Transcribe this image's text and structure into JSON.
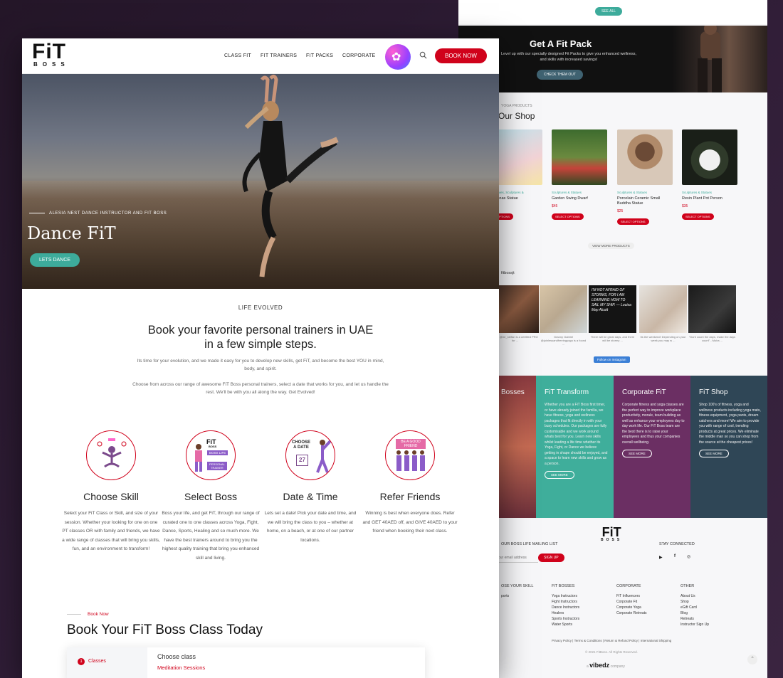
{
  "back": {
    "see_all": "SEE ALL",
    "fit_pack": {
      "title": "Get A Fit Pack",
      "text": "Level up with our specially designed Fit Packs to give you enhanced wellness, and skills with increased savings!",
      "button": "CHECK THEM OUT"
    },
    "shop": {
      "kicker": "YOGA PRODUCTS",
      "title": "Our Shop",
      "products": [
        {
          "category": "Decoratives, Sculptures &",
          "name": "n Bananas Statue",
          "price": "$5",
          "button": "ECT OPTIONS"
        },
        {
          "category": "Sculptures & Statues",
          "name": "Garden Swing Dwarf",
          "price": "$45",
          "button": "SELECT OPTIONS"
        },
        {
          "category": "Sculptures & Statues",
          "name": "Porcelain Ceramic Small Buddha Statue",
          "price": "$25",
          "button": "SELECT OPTIONS"
        },
        {
          "category": "Sculptures & Statues",
          "name": "Resin Plant Pot Person",
          "price": "$35",
          "button": "SELECT OPTIONS"
        }
      ],
      "view_more": "VIEW MORE PRODUCTS"
    },
    "instagram": {
      "handle": "fitbossjt",
      "captions": [
        "Ahhh @mr_stefan is a certified PRO for ...",
        "Granny Gabriel @joinlessandfreeingyoga is a found ...",
        "There will be great days, and there will be stormy ...",
        "Its the weekend! Depending on your week you may w ...",
        "\"Dont count the days, make the days count\" - Muha ..."
      ],
      "quote": "I'M NOT AFRAID OF STORMS, FOR I AM LEARNING HOW TO SAIL MY SHIP. — Louisa May Alcott",
      "follow": "Follow on Instagram"
    },
    "panels": [
      {
        "title": "Bosses",
        "text": "",
        "button": ""
      },
      {
        "title": "FiT Transform",
        "text": "Whether you are a FiT Boss first timer, or have already joined the familia, we have fitness, yoga and wellness packages that fit directly in with your busy schedules. Our packages are fully customisable and we work around whats best for you. Learn new skills whilst leading a life time whether its Yoga, Fight, or Dance we believe getting in shape should be enjoyed, and a space to learn new skills and grow as a person.",
        "button": "SEE MORE"
      },
      {
        "title": "Corporate FiT",
        "text": "Corporate fitness and yoga classes are the perfect way to improve workplace productivity, morale, team building as well as enhance your employees day to day work life. Our FiT Boss team are the best there is to raise your employees and thus your companies overall wellbeing.",
        "button": "SEE MORE"
      },
      {
        "title": "FiT Shop",
        "text": "Shop 100's of fitness, yoga and wellness products including yoga mats, fitness equipment, yoga pants, dream catchers and more! We aim to provide you with range of cool, trending products at great prices. We eliminate the middle man so you can shop from the source at the cheapest prices!",
        "button": "SEE MORE"
      }
    ],
    "footer": {
      "mailing": "OUR BOSS LIFE MAILING LIST",
      "email_placeholder": "our email address",
      "sign_up": "SIGN UP",
      "stay_connected": "STAY CONNECTED",
      "col1": {
        "title": "OSE YOUR SKILL",
        "items": [
          "",
          "",
          "",
          "",
          "",
          "",
          "ports"
        ]
      },
      "col2": {
        "title": "FiT BOSSES",
        "items": [
          "Yoga Instructors",
          "Fight Instructors",
          "Dance Instructors",
          "Healers",
          "Sports Instructors",
          "Water Sports"
        ]
      },
      "col3": {
        "title": "CORPORATE",
        "items": [
          "FiT Influencers",
          "Corporate Fit",
          "Corporate Yoga",
          "Corporate Retreats"
        ]
      },
      "col4": {
        "title": "OTHER",
        "items": [
          "About Us",
          "Shop",
          "eGift Card",
          "Blog",
          "Retreats",
          "Instructor Sign Up"
        ]
      },
      "legal": "Privacy Policy | Terms & Conditions | Return & Refund Policy | International Shipping",
      "copyright": "© 2021 FitBoss. All Rights Reserved.",
      "company_pre": "a",
      "company": "vibedz",
      "company_post": "company"
    }
  },
  "header": {
    "logo_top": "FiT",
    "logo_bottom": "BOSS",
    "nav": [
      "CLASS FIT",
      "FIT TRAINERS",
      "FIT PACKS",
      "CORPORATE"
    ],
    "book_now": "BOOK NOW"
  },
  "hero": {
    "tagline": "ALESIA NEST DANCE INSTRUCTOR AND FIT BOSS",
    "title": "Dance FiT",
    "button": "LETS DANCE"
  },
  "intro": {
    "kicker": "LIFE EVOLVED",
    "heading_line1": "Book your favorite personal trainers in UAE",
    "heading_line2": "in a few simple steps.",
    "para1": "Its time for your evolution, and we made it easy for you to develop new skills, get FiT, and become the best YOU in mind, body, and spirit.",
    "para2": "Choose from across our range of awesome FiT Boss personal trainers, select a date that works for you, and let us handle the rest. We'll be with you all along the way. Get Evolved!"
  },
  "steps": [
    {
      "title": "Choose Skill",
      "text": "Select your FiT Class or Skill, and size of your session. Whether your looking for one on one PT classes OR with family and friends, we have a wide range of classes that will bring you skills, fun, and an environment to transform!"
    },
    {
      "title": "Select Boss",
      "text": "Boss your life, and get FiT, through our range of curated one to one classes across Yoga, Fight, Dance, Sports, Healing and so much more. We have the best trainers around to bring you the highest quality training that bring you enhanced skill and living."
    },
    {
      "title": "Date & Time",
      "text": "Lets set a date! Pick your date and time, and we will bring the class to you – whether at home, on a beach, or at one of our partner locations."
    },
    {
      "title": "Refer Friends",
      "text": "Winning is best when everyone does. Refer and GET 40AED off, and GIVE 40AED to your friend when booking their next class."
    }
  ],
  "icons": {
    "step2_lines": [
      "FiT",
      "BOSS",
      "BOSS LIFE",
      "PERSONAL",
      "TRAINER"
    ],
    "step3_lines": [
      "CHOOSE",
      "A DATE",
      "27"
    ],
    "step4_lines": [
      "BE A GOOD",
      "FRIEND"
    ]
  },
  "booking": {
    "kicker": "Book Now",
    "title": "Book Your FiT Boss Class Today",
    "step_num": "1",
    "step_label": "Classes",
    "choose": "Choose class",
    "option": "Meditation Sessions"
  },
  "colors": {
    "brand_red": "#d0021b",
    "teal": "#3dab9b"
  }
}
